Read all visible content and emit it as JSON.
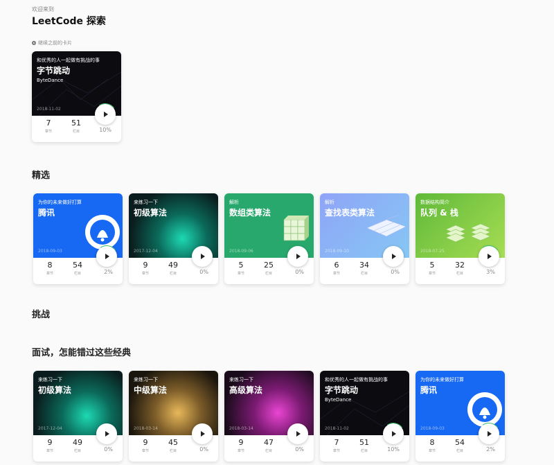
{
  "header": {
    "welcome": "欢迎来到",
    "title": "LeetCode 探索"
  },
  "continue_label": "继续之前的卡片",
  "sections": {
    "featured": "精选",
    "challenge": "挑战",
    "interview": "面试，怎能错过这些经典"
  },
  "stat_labels": {
    "chapters": "章节",
    "items": "栏目"
  },
  "cards": {
    "continue": [
      {
        "sub": "和优秀的人一起做有挑战的事",
        "main": "字节跳动",
        "brand": "ByteDance",
        "date": "2018-11-02",
        "chapters": "7",
        "items": "51",
        "pct": "10%"
      }
    ],
    "featured": [
      {
        "sub": "为你的未来做好打算",
        "main": "腾讯",
        "date": "2018-09-03",
        "chapters": "8",
        "items": "54",
        "pct": "2%"
      },
      {
        "sub": "来练习一下",
        "main": "初级算法",
        "date": "2017-12-04",
        "chapters": "9",
        "items": "49",
        "pct": "0%"
      },
      {
        "sub": "解析",
        "main": "数组类算法",
        "date": "2018-09-06",
        "chapters": "5",
        "items": "25",
        "pct": "0%"
      },
      {
        "sub": "解析",
        "main": "查找表类算法",
        "date": "2018-09-10",
        "chapters": "6",
        "items": "34",
        "pct": "0%"
      },
      {
        "sub": "数据结构简介",
        "main": "队列 & 栈",
        "date": "2018-07-25",
        "chapters": "5",
        "items": "32",
        "pct": "3%"
      }
    ],
    "interview": [
      {
        "sub": "来练习一下",
        "main": "初级算法",
        "date": "2017-12-04",
        "chapters": "9",
        "items": "49",
        "pct": "0%"
      },
      {
        "sub": "来练习一下",
        "main": "中级算法",
        "date": "2018-03-14",
        "chapters": "9",
        "items": "45",
        "pct": "0%"
      },
      {
        "sub": "来练习一下",
        "main": "高级算法",
        "date": "2018-03-14",
        "chapters": "9",
        "items": "47",
        "pct": "0%"
      },
      {
        "sub": "和优秀的人一起做有挑战的事",
        "main": "字节跳动",
        "brand": "ByteDance",
        "date": "2018-11-02",
        "chapters": "7",
        "items": "51",
        "pct": "10%"
      },
      {
        "sub": "为你的未来做好打算",
        "main": "腾讯",
        "date": "2018-09-03",
        "chapters": "8",
        "items": "54",
        "pct": "2%"
      }
    ]
  }
}
